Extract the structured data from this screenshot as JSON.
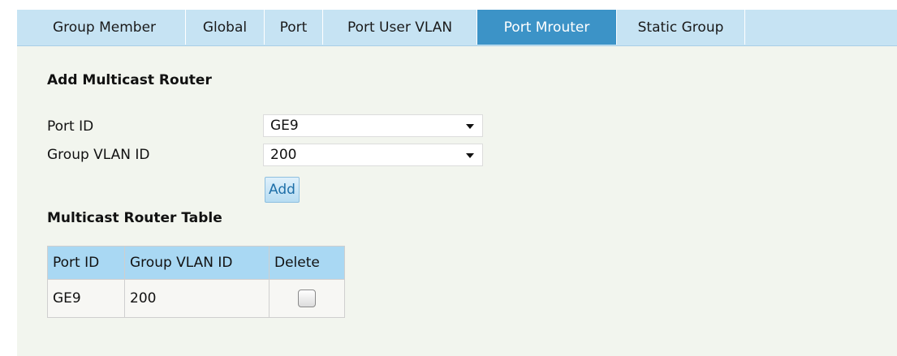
{
  "tabs": [
    {
      "label": "Group Member"
    },
    {
      "label": "Global"
    },
    {
      "label": "Port"
    },
    {
      "label": "Port User VLAN"
    },
    {
      "label": "Port Mrouter",
      "active": true
    },
    {
      "label": "Static Group"
    }
  ],
  "add_section": {
    "title": "Add Multicast Router",
    "port_id_label": "Port ID",
    "port_id_value": "GE9",
    "group_vlan_label": "Group VLAN ID",
    "group_vlan_value": "200",
    "add_button": "Add"
  },
  "table_section": {
    "title": "Multicast Router Table",
    "headers": [
      "Port ID",
      "Group VLAN ID",
      "Delete"
    ],
    "rows": [
      {
        "port_id": "GE9",
        "group_vlan_id": "200",
        "delete_checked": false
      }
    ]
  },
  "colors": {
    "tabbar_bg": "#c6e3f3",
    "active_tab_bg": "#3c93c7",
    "table_header_bg": "#a9d8f3",
    "panel_bg": "#f2f5ee"
  }
}
